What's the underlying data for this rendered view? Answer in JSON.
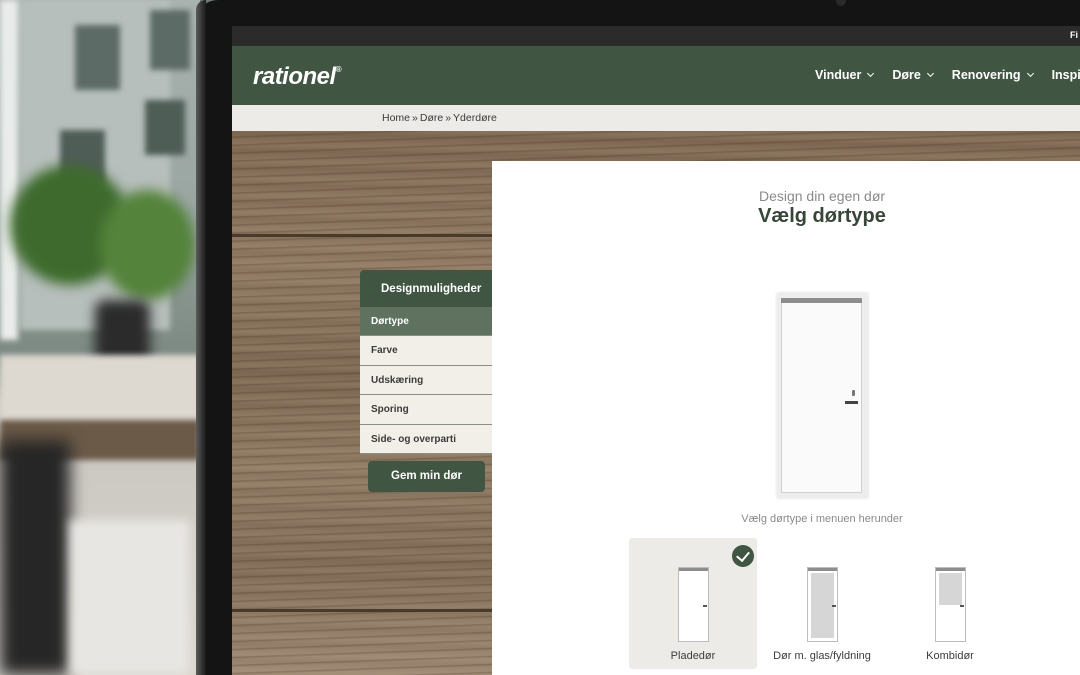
{
  "header": {
    "logo": "rationel",
    "logo_mark": "®",
    "corner_text": "Fi",
    "nav": [
      {
        "label": "Vinduer"
      },
      {
        "label": "Døre"
      },
      {
        "label": "Renovering"
      },
      {
        "label": "Inspiration"
      }
    ]
  },
  "breadcrumb": {
    "items": [
      "Home",
      "Døre",
      "Yderdøre"
    ],
    "separator": "»"
  },
  "design_menu": {
    "heading": "Designmuligheder",
    "items": [
      {
        "label": "Dørtype",
        "active": true
      },
      {
        "label": "Farve",
        "active": false
      },
      {
        "label": "Udskæring",
        "active": false
      },
      {
        "label": "Sporing",
        "active": false
      },
      {
        "label": "Side- og overparti",
        "active": false
      }
    ],
    "save_label": "Gem min dør"
  },
  "configurator": {
    "subtitle": "Design din egen dør",
    "title": "Vælg dørtype",
    "hint": "Vælg dørtype i menuen herunder",
    "door_types": [
      {
        "label": "Pladedør",
        "selected": true,
        "icon": "solid-door-icon"
      },
      {
        "label": "Dør m. glas/fyldning",
        "selected": false,
        "icon": "glass-door-icon"
      },
      {
        "label": "Kombidør",
        "selected": false,
        "icon": "combi-door-icon"
      }
    ]
  },
  "colors": {
    "brand_green": "#415543",
    "active_menu": "#5e725f",
    "menu_bg": "#f1efe7",
    "crumb_bg": "#ecebe8"
  }
}
